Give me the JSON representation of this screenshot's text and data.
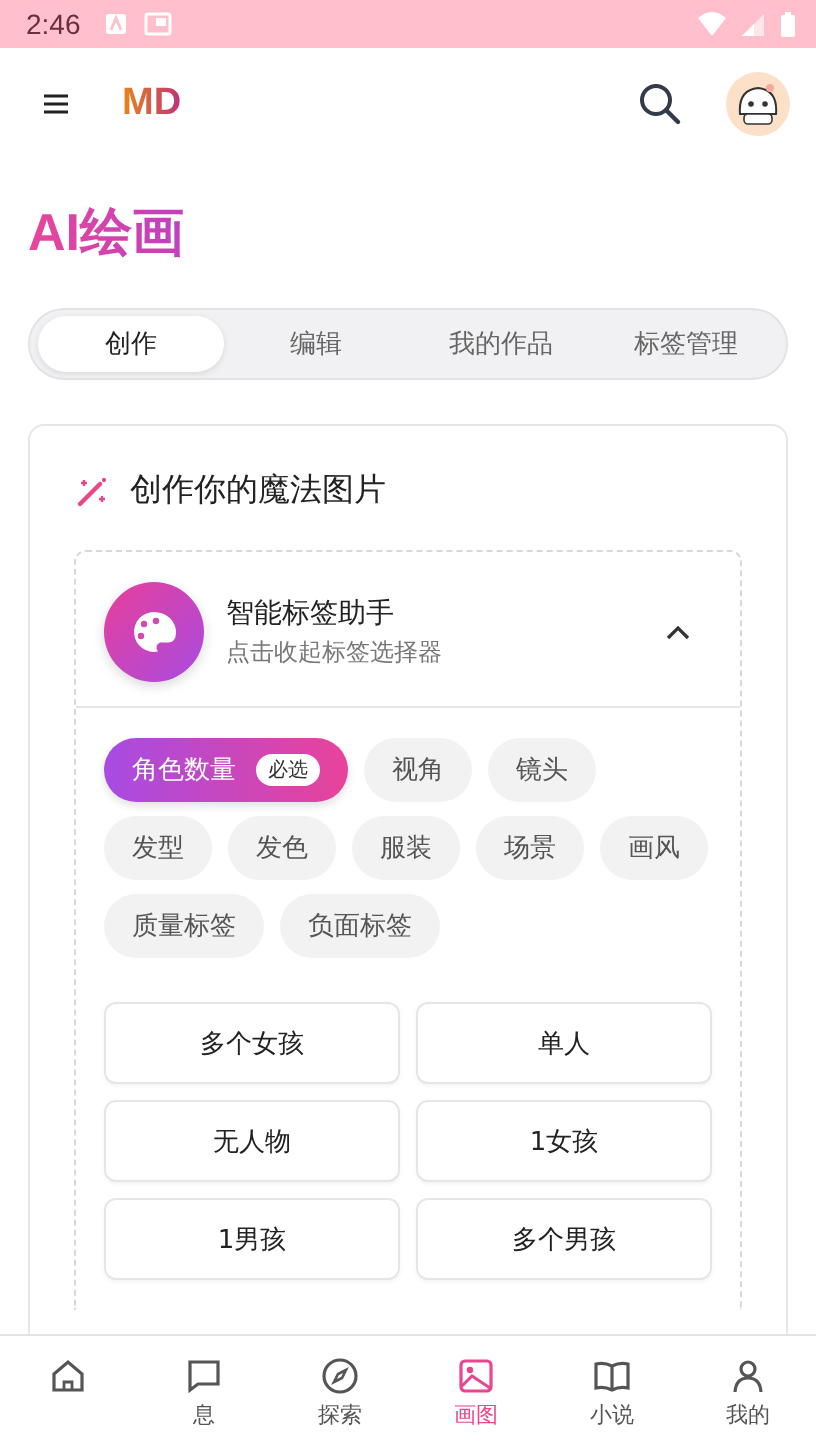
{
  "status_bar": {
    "time": "2:46"
  },
  "app_bar": {
    "logo": "MD"
  },
  "page_title": "AI绘画",
  "tabs": [
    {
      "label": "创作",
      "selected": true
    },
    {
      "label": "编辑",
      "selected": false
    },
    {
      "label": "我的作品",
      "selected": false
    },
    {
      "label": "标签管理",
      "selected": false
    }
  ],
  "card": {
    "title": "创作你的魔法图片",
    "assistant": {
      "title": "智能标签助手",
      "subtitle": "点击收起标签选择器",
      "expanded": true
    },
    "categories": [
      {
        "label": "角色数量",
        "selected": true,
        "badge": "必选"
      },
      {
        "label": "视角",
        "selected": false
      },
      {
        "label": "镜头",
        "selected": false
      },
      {
        "label": "发型",
        "selected": false
      },
      {
        "label": "发色",
        "selected": false
      },
      {
        "label": "服装",
        "selected": false
      },
      {
        "label": "场景",
        "selected": false
      },
      {
        "label": "画风",
        "selected": false
      },
      {
        "label": "质量标签",
        "selected": false
      },
      {
        "label": "负面标签",
        "selected": false
      }
    ],
    "options": [
      "多个女孩",
      "单人",
      "无人物",
      "1女孩",
      "1男孩",
      "多个男孩"
    ]
  },
  "bottom_nav": [
    {
      "kind": "home",
      "selected": false
    },
    {
      "kind": "chat",
      "label": "息",
      "selected": false
    },
    {
      "kind": "compass",
      "label": "探索",
      "selected": false
    },
    {
      "kind": "image",
      "label": "画图",
      "selected": true
    },
    {
      "kind": "book",
      "label": "小说",
      "selected": false
    },
    {
      "kind": "person",
      "label": "我的",
      "selected": false
    }
  ]
}
